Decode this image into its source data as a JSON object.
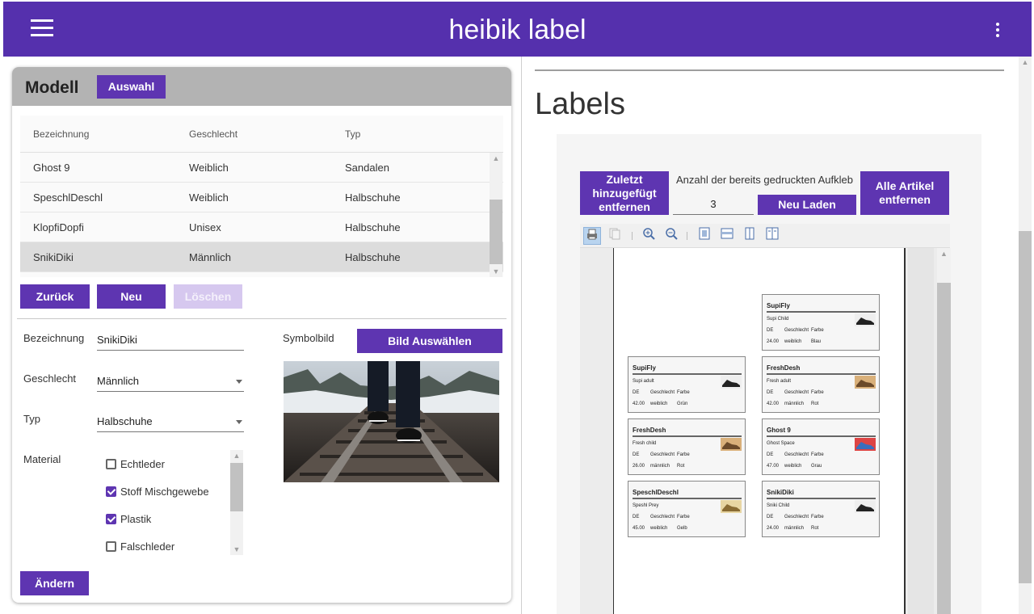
{
  "app": {
    "title": "heibik label"
  },
  "model_card": {
    "heading": "Modell",
    "auswahl_button": "Auswahl",
    "columns": [
      "Bezeichnung",
      "Geschlecht",
      "Typ"
    ],
    "rows": [
      [
        "Ghost 9",
        "Weiblich",
        "Sandalen"
      ],
      [
        "SpeschlDeschl",
        "Weiblich",
        "Halbschuhe"
      ],
      [
        "KlopfiDopfi",
        "Unisex",
        "Halbschuhe"
      ],
      [
        "SnikiDiki",
        "Männlich",
        "Halbschuhe"
      ]
    ],
    "buttons": {
      "back": "Zurück",
      "new": "Neu",
      "delete": "Löschen",
      "change": "Ändern"
    },
    "form": {
      "name_label": "Bezeichnung",
      "name_value": "SnikiDiki",
      "gender_label": "Geschlecht",
      "gender_value": "Männlich",
      "type_label": "Typ",
      "type_value": "Halbschuhe",
      "material_label": "Material",
      "materials": [
        {
          "label": "Echtleder",
          "checked": false
        },
        {
          "label": "Stoff Mischgewebe",
          "checked": true
        },
        {
          "label": "Plastik",
          "checked": true
        },
        {
          "label": "Falschleder",
          "checked": false
        }
      ],
      "image_label": "Symbolbild",
      "image_button": "Bild Auswählen"
    }
  },
  "labels_panel": {
    "title": "Labels",
    "remove_last_button": "Zuletzt hinzugefügt entfernen",
    "count_label": "Anzahl der bereits gedruckten Aufkleb",
    "count_value": "3",
    "reload_button": "Neu Laden",
    "remove_all_button": "Alle Artikel entfernen",
    "labels": [
      {
        "name": "SupiFly",
        "sub": "Supi Child",
        "h1": "DE",
        "h2": "Geschlecht",
        "h3": "Farbe",
        "v1": "24.00",
        "v2": "weiblich",
        "v3": "Blau",
        "img": "shoe-bw"
      },
      {
        "name": "SupiFly",
        "sub": "Supi adult",
        "h1": "DE",
        "h2": "Geschlecht",
        "h3": "Farbe",
        "v1": "42.00",
        "v2": "weiblich",
        "v3": "Grün",
        "img": "shoe-bw"
      },
      {
        "name": "FreshDesh",
        "sub": "Fresh adult",
        "h1": "DE",
        "h2": "Geschlecht",
        "h3": "Farbe",
        "v1": "42.00",
        "v2": "männlich",
        "v3": "Rot",
        "img": "shoe-brown"
      },
      {
        "name": "FreshDesh",
        "sub": "Fresh child",
        "h1": "DE",
        "h2": "Geschlecht",
        "h3": "Farbe",
        "v1": "26.00",
        "v2": "männlich",
        "v3": "Rot",
        "img": "shoe-brown"
      },
      {
        "name": "Ghost 9",
        "sub": "Ghost Space",
        "h1": "DE",
        "h2": "Geschlecht",
        "h3": "Farbe",
        "v1": "47.00",
        "v2": "weiblich",
        "v3": "Grau",
        "img": "shoe-colorful"
      },
      {
        "name": "SpeschlDeschl",
        "sub": "Speshl Prey",
        "h1": "DE",
        "h2": "Geschlecht",
        "h3": "Farbe",
        "v1": "45.00",
        "v2": "weiblich",
        "v3": "Gelb",
        "img": "shoe-gold"
      },
      {
        "name": "SnikiDiki",
        "sub": "Sniki Child",
        "h1": "DE",
        "h2": "Geschlecht",
        "h3": "Farbe",
        "v1": "24.00",
        "v2": "männlich",
        "v3": "Rot",
        "img": "shoe-bw"
      }
    ]
  },
  "colors": {
    "primary": "#5530ad",
    "button": "#5e35b1",
    "card_header": "#b3b3b3"
  }
}
